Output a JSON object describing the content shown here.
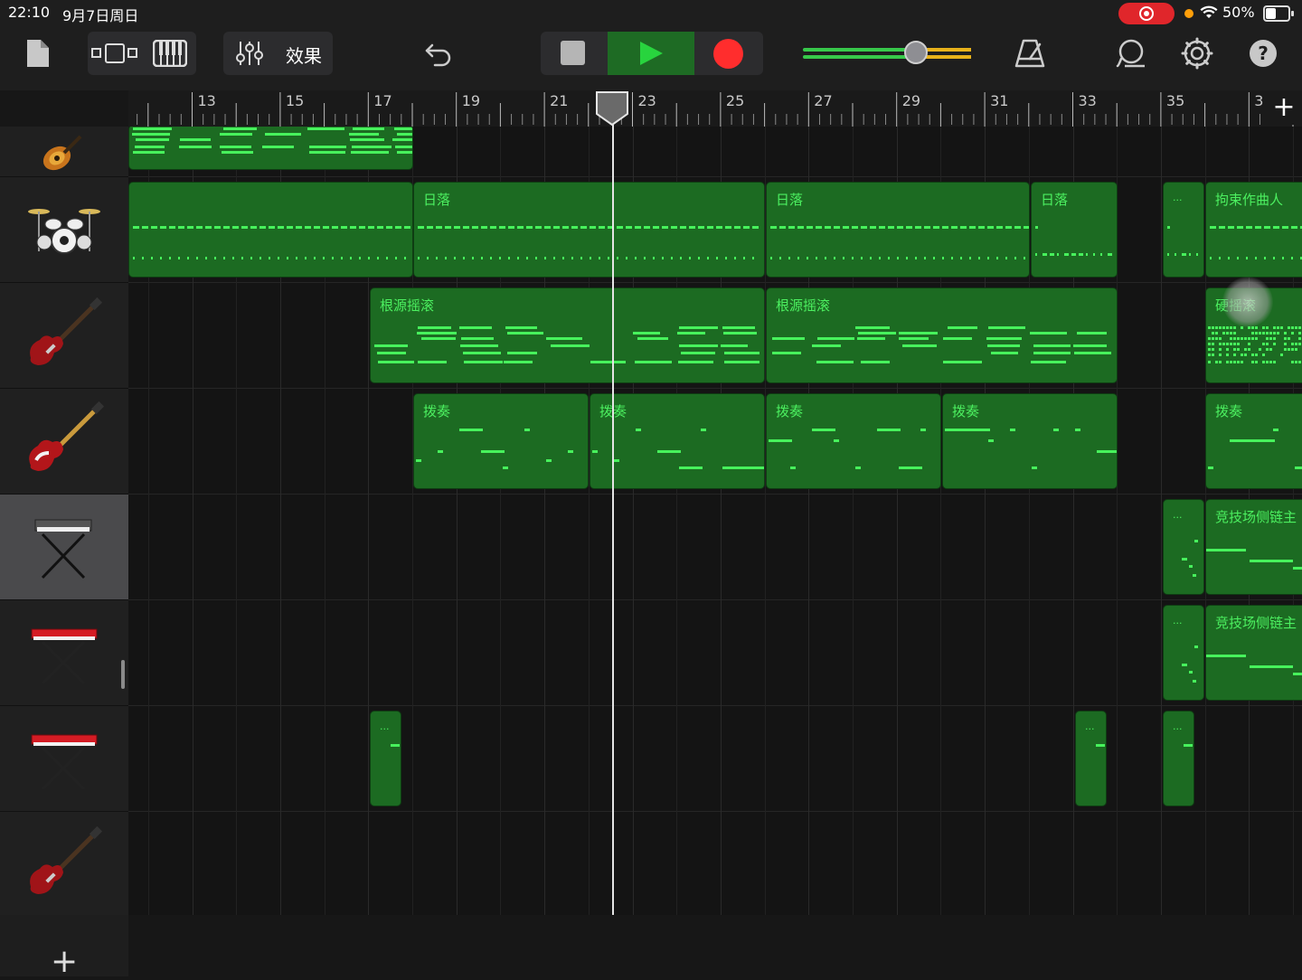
{
  "status_bar": {
    "time": "22:10",
    "date": "9月7日周日",
    "battery": "50%",
    "battery_level": 0.5
  },
  "toolbar": {
    "effects_label": "效果",
    "volume_level": 0.68,
    "icons": [
      "document-icon",
      "tracks-view-icon",
      "keyboard-icon",
      "mixer-icon",
      "undo-icon",
      "stop-icon",
      "play-icon",
      "record-icon",
      "metronome-icon",
      "loop-icon",
      "settings-icon",
      "help-icon"
    ]
  },
  "ruler": {
    "bars": [
      "13",
      "15",
      "17",
      "19",
      "21",
      "23",
      "25",
      "27",
      "29",
      "31",
      "33",
      "35",
      "3"
    ],
    "add_label": "+"
  },
  "tracks": [
    {
      "instrument": "acoustic-guitar",
      "regions": [
        {
          "label": ""
        }
      ]
    },
    {
      "instrument": "drum-kit",
      "regions": [
        {
          "label": ""
        },
        {
          "label": "日落"
        },
        {
          "label": "日落"
        },
        {
          "label": "日落"
        },
        {
          "label": "..."
        },
        {
          "label": "拘束作曲人"
        }
      ]
    },
    {
      "instrument": "electric-guitar",
      "regions": [
        {
          "label": "根源摇滚"
        },
        {
          "label": "根源摇滚"
        },
        {
          "label": "硬摇滚"
        }
      ]
    },
    {
      "instrument": "bass-guitar",
      "regions": [
        {
          "label": "拨奏"
        },
        {
          "label": "拨奏"
        },
        {
          "label": "拨奏"
        },
        {
          "label": "拨奏"
        },
        {
          "label": "拨奏"
        }
      ]
    },
    {
      "instrument": "keyboard",
      "selected": true,
      "regions": [
        {
          "label": "..."
        },
        {
          "label": "竞技场侧链主"
        }
      ]
    },
    {
      "instrument": "red-synth",
      "regions": [
        {
          "label": "..."
        },
        {
          "label": "竞技场侧链主"
        }
      ]
    },
    {
      "instrument": "red-synth",
      "regions": [
        {
          "label": "..."
        },
        {
          "label": "..."
        },
        {
          "label": "..."
        }
      ]
    },
    {
      "instrument": "electric-guitar",
      "regions": []
    }
  ],
  "add_track_label": "+",
  "colors": {
    "region": "#1c6b22",
    "notes": "#47f25c",
    "label": "#4cf060",
    "record": "#ff2d2d",
    "play": "#28d43e"
  }
}
